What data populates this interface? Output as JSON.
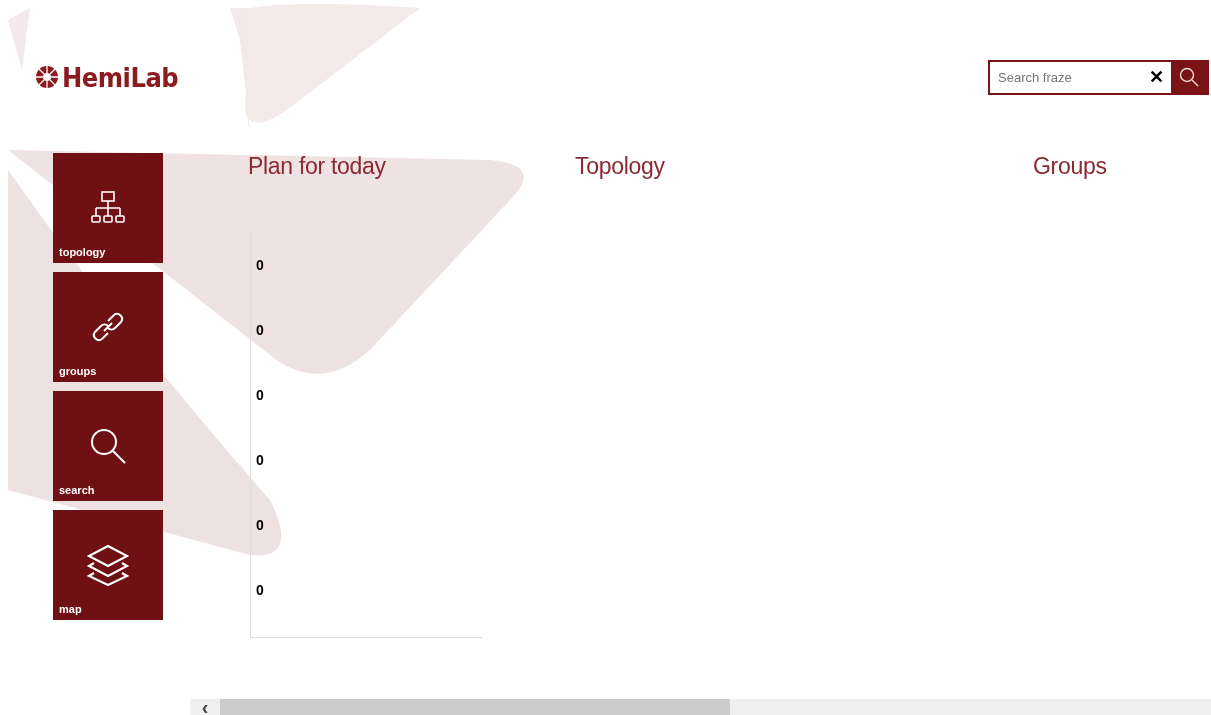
{
  "logo": {
    "text": "HemiLab"
  },
  "search": {
    "placeholder": "Search fraze",
    "clear": "✕"
  },
  "tiles": [
    {
      "label": "topology",
      "kind": "topology"
    },
    {
      "label": "groups",
      "kind": "groups"
    },
    {
      "label": "search",
      "kind": "search"
    },
    {
      "label": "map",
      "kind": "map"
    }
  ],
  "sections": [
    {
      "title": "Plan for today",
      "items": [
        "0",
        "0",
        "0",
        "0",
        "0",
        "0"
      ]
    },
    {
      "title": "Topology"
    },
    {
      "title": "Groups"
    }
  ],
  "scrollbar": {
    "arrow": "‹"
  }
}
